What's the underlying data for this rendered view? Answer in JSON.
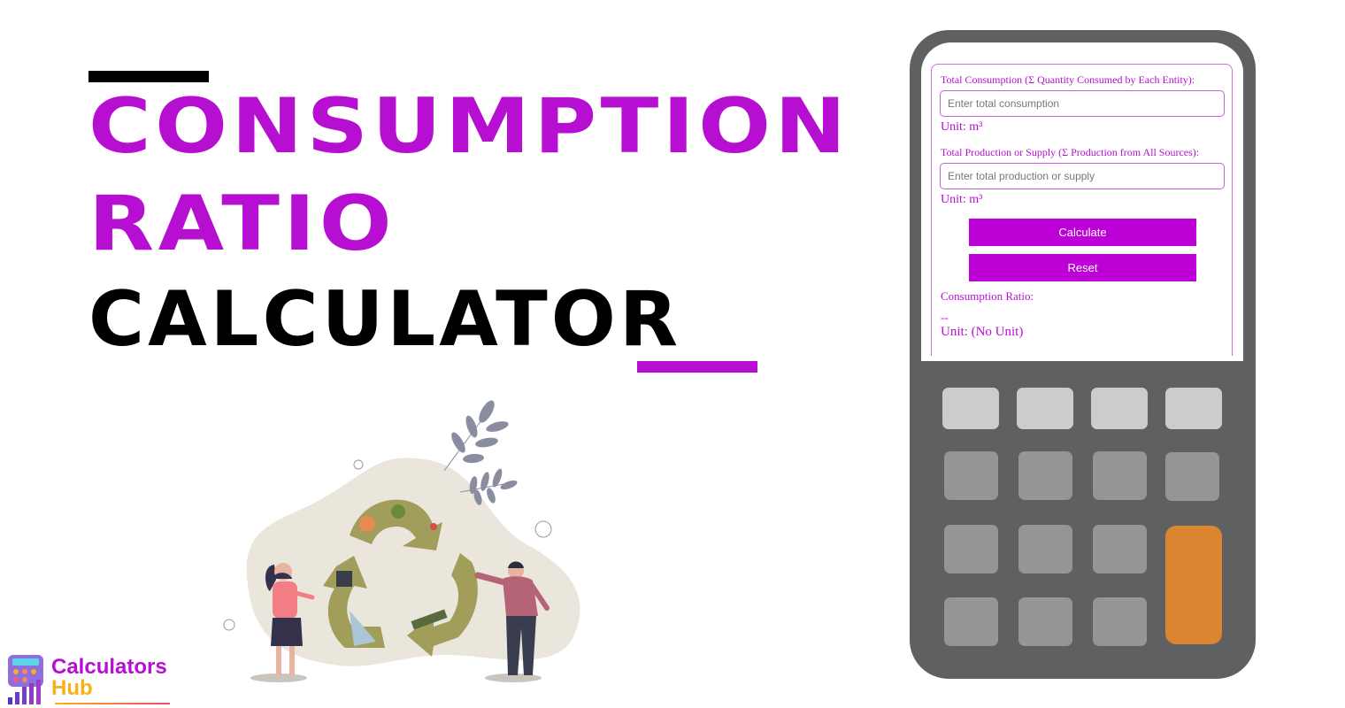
{
  "headline": {
    "line1": "CONSUMPTION",
    "line2": "RATIO",
    "line3": "CALCULATOR"
  },
  "colors": {
    "accent": "#b70fd2",
    "button": "#bd00d6",
    "calculator_body": "#5f6062",
    "key_light": "#cdccca",
    "key_mid": "#959595",
    "key_orange": "#db8530"
  },
  "form": {
    "field1": {
      "label": "Total Consumption (Σ Quantity Consumed by Each Entity):",
      "placeholder": "Enter total consumption",
      "value": "",
      "unit": "Unit: m³"
    },
    "field2": {
      "label": "Total Production or Supply (Σ Production from All Sources):",
      "placeholder": "Enter total production or supply",
      "value": "",
      "unit": "Unit: m³"
    },
    "calculate_label": "Calculate",
    "reset_label": "Reset",
    "result": {
      "label": "Consumption Ratio:",
      "value": "--",
      "unit": "Unit: (No Unit)"
    }
  },
  "logo": {
    "line1": "Calculators",
    "line2": "Hub"
  },
  "illustration": {
    "description": "Two people beside a recycling symbol with leaves"
  }
}
